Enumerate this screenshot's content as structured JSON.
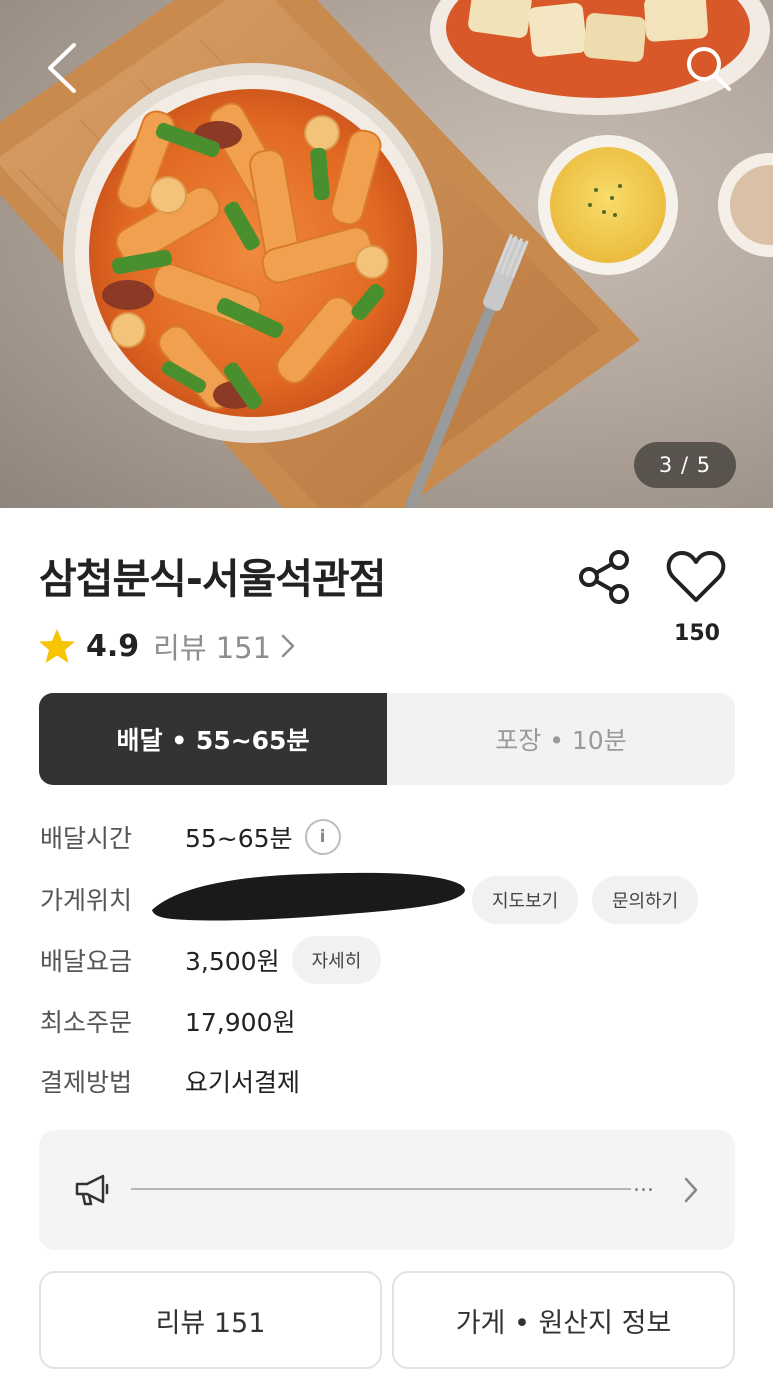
{
  "hero": {
    "photo_counter": "3 / 5",
    "back_icon": "chevron-left-icon",
    "search_icon": "search-icon"
  },
  "store": {
    "name": "삼첩분식-서울석관점",
    "rating": "4.9",
    "review_label": "리뷰 151",
    "like_count": "150",
    "rating_star_color": "#f6c400"
  },
  "tabs": [
    {
      "label": "배달 • 55~65분",
      "active": true
    },
    {
      "label": "포장 • 10분",
      "active": false
    }
  ],
  "details": {
    "delivery_time": {
      "label": "배달시간",
      "value": "55~65분",
      "info_icon": "i"
    },
    "location": {
      "label": "가게위치",
      "map_button": "지도보기",
      "inquiry_button": "문의하기"
    },
    "delivery_fee": {
      "label": "배달요금",
      "value": "3,500원",
      "detail_button": "자세히"
    },
    "min_order": {
      "label": "최소주문",
      "value": "17,900원"
    },
    "payment": {
      "label": "결제방법",
      "value": "요기서결제"
    }
  },
  "notice": {
    "icon": "megaphone-icon",
    "ellipsis": "..."
  },
  "bottom": {
    "reviews_button": "리뷰 151",
    "store_info_button": "가게 • 원산지 정보"
  },
  "colors": {
    "active_tab_bg": "#333333",
    "inactive_tab_bg": "#f2f2f2",
    "muted_text": "#8e8e8e"
  }
}
